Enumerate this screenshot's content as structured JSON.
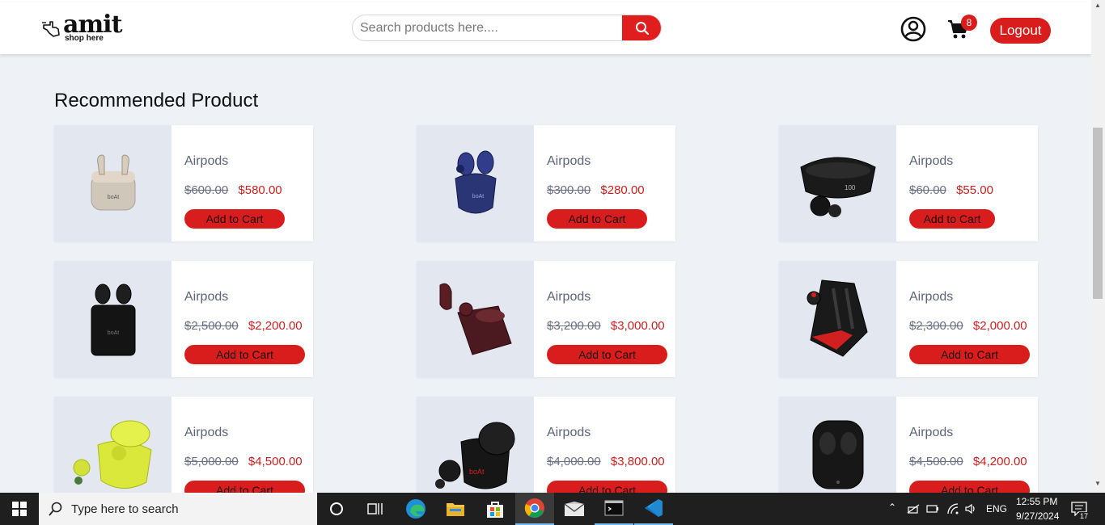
{
  "brand": {
    "name": "amit",
    "tagline": "shop here"
  },
  "search": {
    "placeholder": "Search products here...."
  },
  "cart": {
    "count": "8"
  },
  "header": {
    "logout_label": "Logout"
  },
  "section": {
    "title": "Recommended Product"
  },
  "products": [
    {
      "name": "Airpods",
      "old_price": "$600.00",
      "price": "$580.00",
      "cta": "Add to Cart"
    },
    {
      "name": "Airpods",
      "old_price": "$300.00",
      "price": "$280.00",
      "cta": "Add to Cart"
    },
    {
      "name": "Airpods",
      "old_price": "$60.00",
      "price": "$55.00",
      "cta": "Add to Cart"
    },
    {
      "name": "Airpods",
      "old_price": "$2,500.00",
      "price": "$2,200.00",
      "cta": "Add to Cart"
    },
    {
      "name": "Airpods",
      "old_price": "$3,200.00",
      "price": "$3,000.00",
      "cta": "Add to Cart"
    },
    {
      "name": "Airpods",
      "old_price": "$2,300.00",
      "price": "$2,000.00",
      "cta": "Add to Cart"
    },
    {
      "name": "Airpods",
      "old_price": "$5,000.00",
      "price": "$4,500.00",
      "cta": "Add to Cart"
    },
    {
      "name": "Airpods",
      "old_price": "$4,000.00",
      "price": "$3,800.00",
      "cta": "Add to Cart"
    },
    {
      "name": "Airpods",
      "old_price": "$4,500.00",
      "price": "$4,200.00",
      "cta": "Add to Cart"
    }
  ],
  "taskbar": {
    "search_placeholder": "Type here to search",
    "language": "ENG",
    "time": "12:55 PM",
    "date": "9/27/2024",
    "notifications": "17"
  },
  "colors": {
    "accent": "#d91d1d",
    "page_bg": "#eef2f7",
    "image_bg": "#e3e8f0"
  }
}
